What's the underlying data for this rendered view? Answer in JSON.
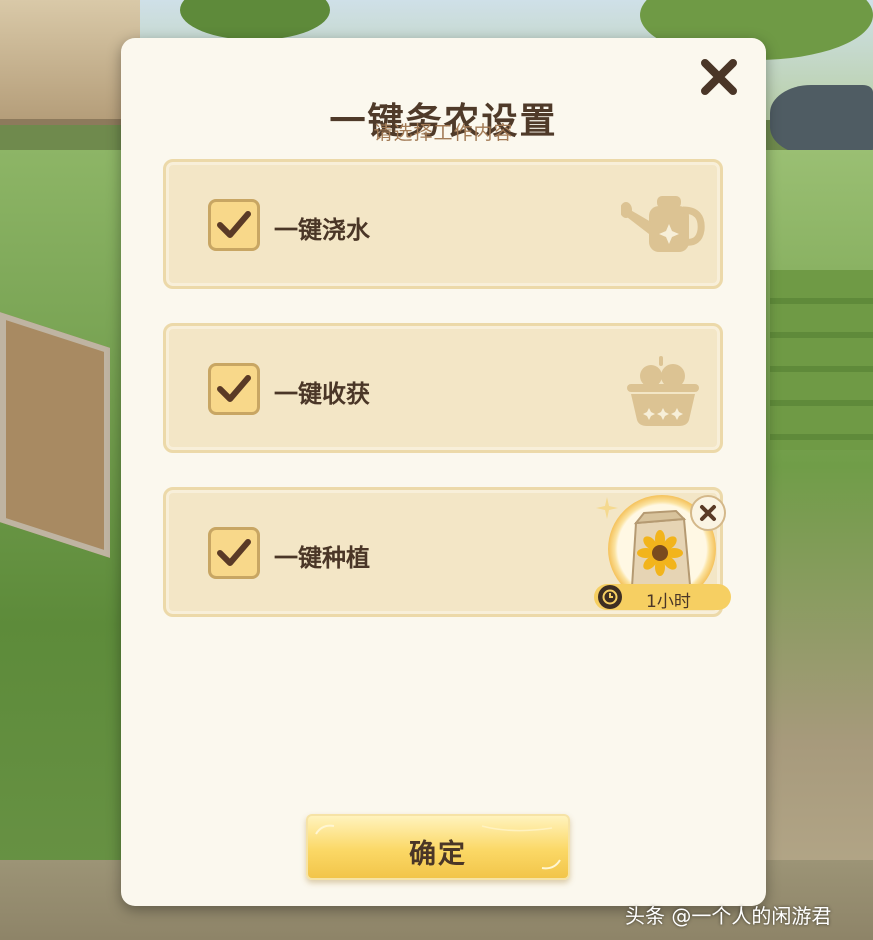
{
  "dialog": {
    "title": "一键务农设置",
    "subtitle": "请选择工作内容",
    "close_icon": "close-icon"
  },
  "options": [
    {
      "label": "一键浇水",
      "checked": true,
      "icon": "watering-can-icon"
    },
    {
      "label": "一键收获",
      "checked": true,
      "icon": "harvest-basket-icon"
    },
    {
      "label": "一键种植",
      "checked": true,
      "icon": "sunflower-seed-bag-icon",
      "seed": {
        "duration": "1小时",
        "remove_icon": "close-icon",
        "timer_icon": "clock-icon"
      }
    }
  ],
  "confirm": {
    "label": "确定"
  },
  "watermark": {
    "text": "头条 @一个人的闲游君"
  },
  "colors": {
    "panel": "#fbf8ee",
    "option_bg": "#f3e6c6",
    "checkbox": "#f8d88a",
    "text_dark": "#4a3627",
    "subtitle": "#a27a55",
    "button_gold": "#fbd866"
  }
}
